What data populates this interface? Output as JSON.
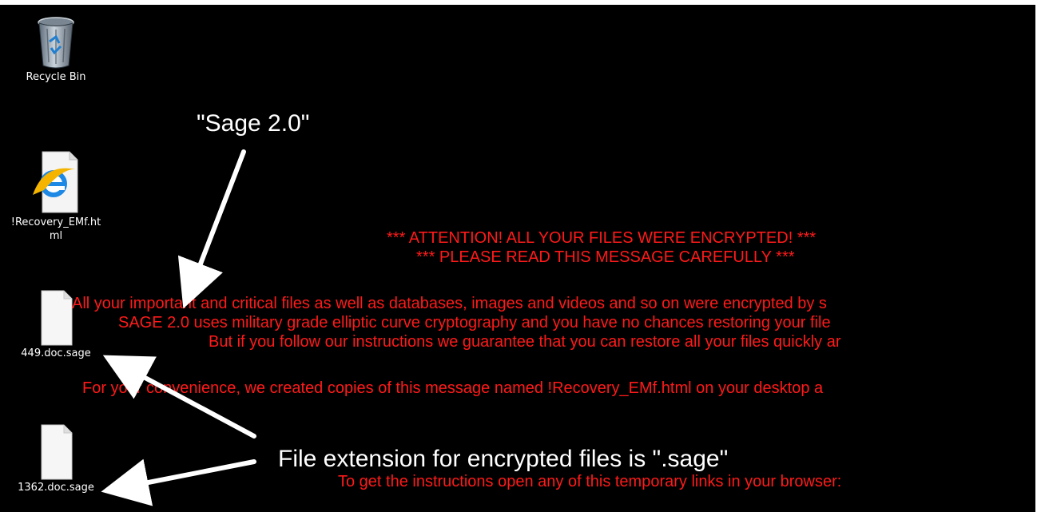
{
  "desktop": {
    "icons": [
      {
        "label": "Recycle Bin",
        "type": "recycle-bin-icon"
      },
      {
        "label": "!Recovery_EMf.html",
        "type": "internet-explorer-file-icon"
      },
      {
        "label": "449.doc.sage",
        "type": "blank-document-icon"
      },
      {
        "label": "1362.doc.sage",
        "type": "blank-document-icon"
      }
    ]
  },
  "ransom_note": {
    "heading_1": "*** ATTENTION! ALL YOUR FILES WERE ENCRYPTED! ***",
    "heading_2": "*** PLEASE READ THIS MESSAGE CAREFULLY ***",
    "line_1": "All your important and critical files as well as databases, images and videos and so on were encrypted by s",
    "line_2": "SAGE 2.0 uses military grade elliptic curve cryptography and you have no chances restoring your file",
    "line_3": "But if you follow our instructions we guarantee that you can restore all your files quickly ar",
    "line_4": "For your convenience, we created copies of this message named !Recovery_EMf.html on your desktop a",
    "line_5": "To get the instructions open any of this temporary links in your browser:"
  },
  "annotations": {
    "sage_label": "\"Sage 2.0\"",
    "extension_label": "File extension for encrypted files is \".sage\""
  },
  "colors": {
    "desktop_background": "#000000",
    "ransom_text": "#ff1a1a",
    "annotation_text": "#ffffff"
  }
}
